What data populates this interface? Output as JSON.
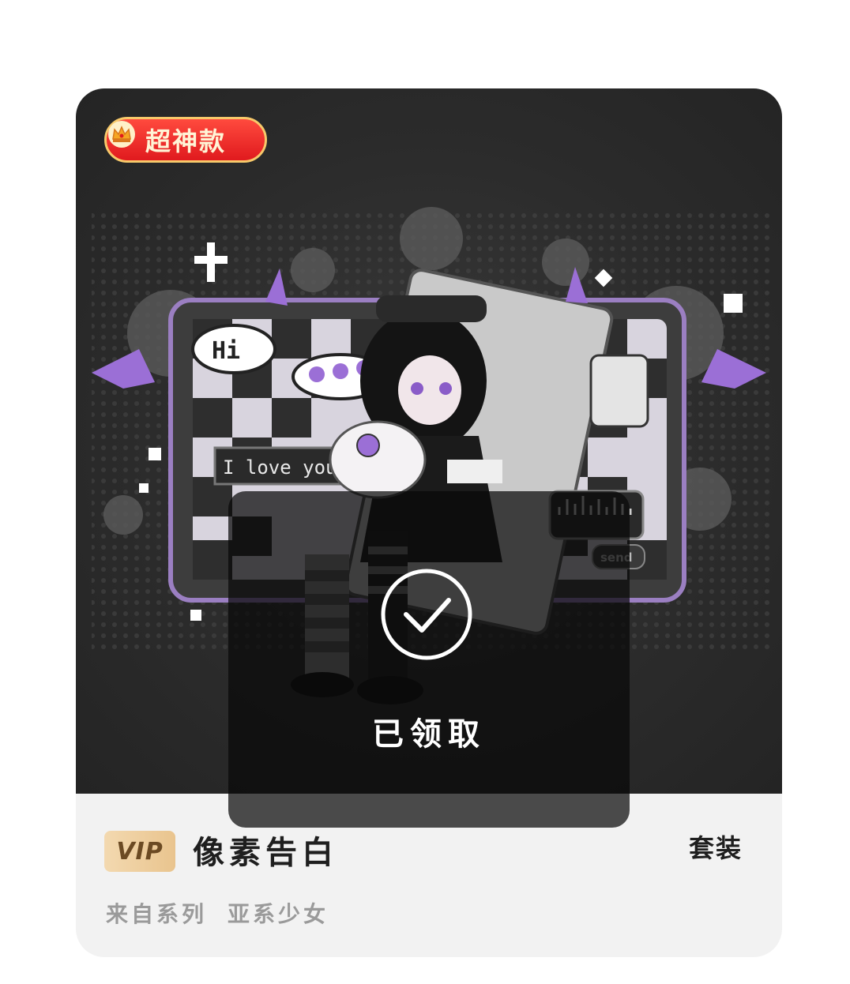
{
  "card": {
    "badge_label": "超神款",
    "badge_icon": "crown-icon",
    "status_label": "已领取",
    "status_icon": "check-circle-icon",
    "vip_label": "VIP",
    "item_title": "像素告白",
    "type_tag": "套装",
    "series_prefix": "来自系列",
    "series_name": "亚系少女",
    "artwork": {
      "speech_hi": "Hi",
      "speech_love": "I love you",
      "send_label": "send"
    },
    "colors": {
      "accent_purple": "#9b6fd6",
      "badge_red": "#e01a1e",
      "badge_gold": "#f7c96a",
      "tag_underline": "#f08a24",
      "vip_gold": "#e9c48e"
    }
  }
}
